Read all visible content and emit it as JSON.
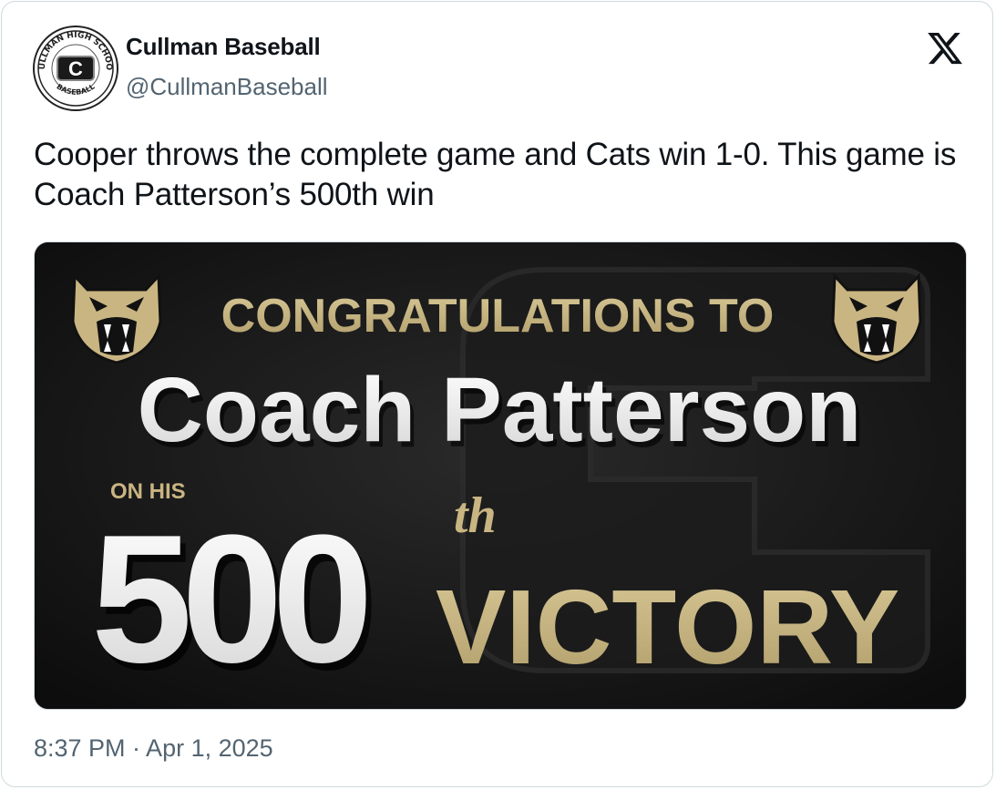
{
  "account": {
    "display_name": "Cullman Baseball",
    "handle": "@CullmanBaseball",
    "avatar_icon": "cullman-high-school-baseball-logo",
    "avatar_text_top": "CULLMAN HIGH SCHOOL",
    "avatar_text_bottom": "BASEBALL",
    "avatar_letter": "C"
  },
  "platform_icon": "x-logo-icon",
  "tweet": {
    "text": "Cooper throws the complete game and Cats win 1-0. This game is Coach Patterson’s 500th win",
    "timestamp": "8:37 PM · Apr 1, 2025"
  },
  "media": {
    "line1": "CONGRATULATIONS TO",
    "line2": "Coach Patterson",
    "line3": "ON HIS",
    "number": "500",
    "suffix": "th",
    "line4": "VICTORY",
    "icon": "panther-mascot-icon",
    "colors": {
      "gold": "#c9b582",
      "background": "#141414",
      "white": "#ffffff"
    }
  }
}
